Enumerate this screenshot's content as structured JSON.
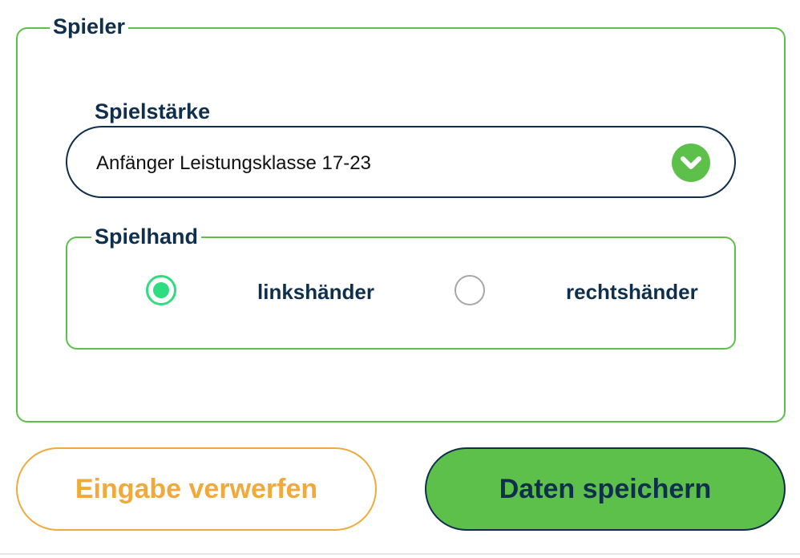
{
  "player_section": {
    "legend": "Spieler"
  },
  "skill": {
    "label": "Spielstärke",
    "selected_value": "Anfänger Leistungsklasse 17-23",
    "icon": "chevron-down-icon",
    "accent_color": "#5dc04a"
  },
  "hand": {
    "legend": "Spielhand",
    "options": [
      {
        "label": "linkshänder",
        "checked": true
      },
      {
        "label": "rechtshänder",
        "checked": false
      }
    ],
    "checked_color": "#2edd7e"
  },
  "actions": {
    "discard_label": "Eingabe verwerfen",
    "discard_color": "#f0aa3c",
    "save_label": "Daten speichern",
    "save_color": "#5dc04a"
  },
  "colors": {
    "text_primary": "#0f2f4d",
    "border_green": "#5dc04a"
  }
}
